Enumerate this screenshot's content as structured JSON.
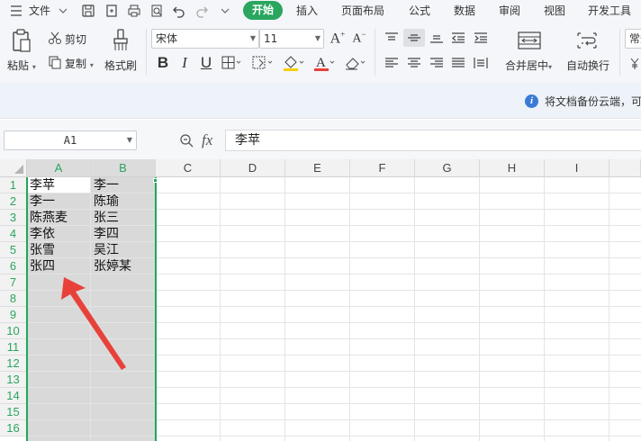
{
  "menu": {
    "file_label": "文件",
    "tabs": [
      "开始",
      "插入",
      "页面布局",
      "公式",
      "数据",
      "审阅",
      "视图",
      "开发工具"
    ]
  },
  "ribbon": {
    "paste": "粘贴",
    "cut": "剪切",
    "copy": "复制",
    "format_painter": "格式刷",
    "font_name": "宋体",
    "font_size": "11",
    "merge_center": "合并居中",
    "wrap_text": "自动换行",
    "number_format": "常规"
  },
  "notice": {
    "text": "将文档备份云端，可"
  },
  "formula_bar": {
    "name_box": "A1",
    "fx": "fx",
    "content": "李苹"
  },
  "sheet": {
    "columns": [
      "A",
      "B",
      "C",
      "D",
      "E",
      "F",
      "G",
      "H",
      "I"
    ],
    "rows": [
      "1",
      "2",
      "3",
      "4",
      "5",
      "6",
      "7",
      "8",
      "9",
      "10",
      "11",
      "12",
      "13",
      "14",
      "15",
      "16"
    ],
    "cells": [
      [
        "李苹",
        "李一"
      ],
      [
        "李一",
        "陈瑜"
      ],
      [
        "陈燕麦",
        "张三"
      ],
      [
        "李依",
        "李四"
      ],
      [
        "张雪",
        "吴江"
      ],
      [
        "张四",
        "张婷某"
      ]
    ],
    "selection": "A1:B16"
  },
  "colors": {
    "accent": "#2aa65f",
    "selection_border": "#1ea85a",
    "annotation_arrow": "#e8413a"
  }
}
